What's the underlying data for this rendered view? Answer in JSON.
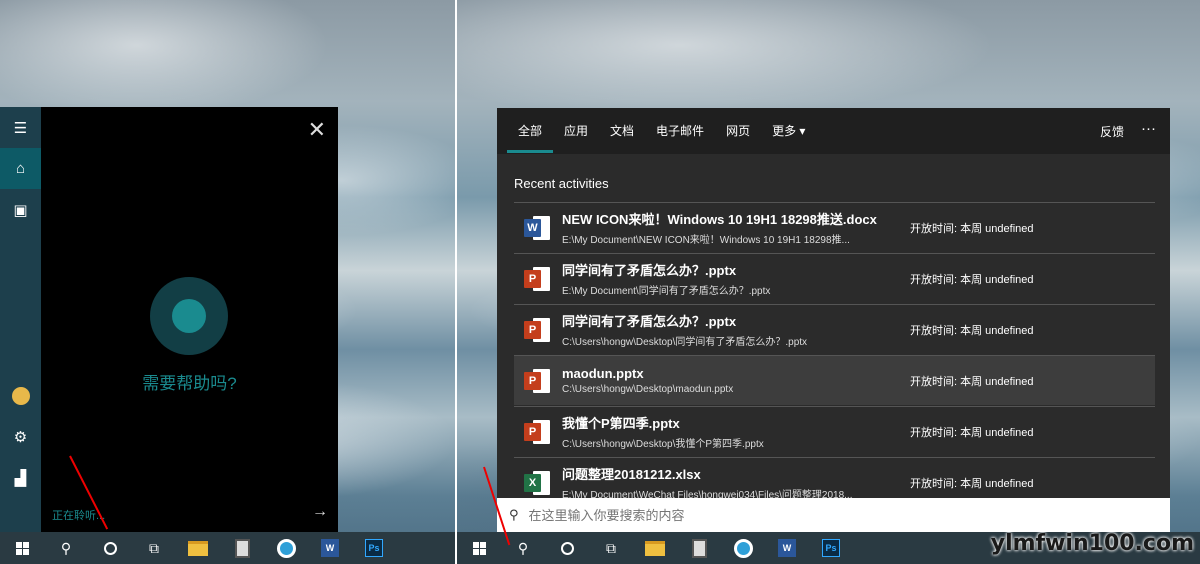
{
  "cortana": {
    "help_text": "需要帮助吗?",
    "listening_text": "正在聆听...",
    "close_glyph": "✕",
    "send_glyph": "→"
  },
  "search": {
    "tabs": [
      {
        "label": "全部"
      },
      {
        "label": "应用"
      },
      {
        "label": "文档"
      },
      {
        "label": "电子邮件"
      },
      {
        "label": "网页"
      },
      {
        "label": "更多 ▾"
      }
    ],
    "feedback_label": "反馈",
    "more_glyph": "···",
    "recent_title": "Recent activities",
    "items": [
      {
        "name": "NEW ICON来啦！Windows 10 19H1 18298推送.docx",
        "path": "E:\\My Document\\NEW ICON来啦！Windows 10 19H1 18298推...",
        "opened": "开放时间: 本周 undefined",
        "icon": "word-icon",
        "letter": "W"
      },
      {
        "name": "同学间有了矛盾怎么办？.pptx",
        "path": "E:\\My Document\\同学间有了矛盾怎么办？.pptx",
        "opened": "开放时间: 本周 undefined",
        "icon": "powerpoint-icon",
        "letter": "P"
      },
      {
        "name": "同学间有了矛盾怎么办？.pptx",
        "path": "C:\\Users\\hongw\\Desktop\\同学间有了矛盾怎么办？.pptx",
        "opened": "开放时间: 本周 undefined",
        "icon": "powerpoint-icon",
        "letter": "P"
      },
      {
        "name": "maodun.pptx",
        "path": "C:\\Users\\hongw\\Desktop\\maodun.pptx",
        "opened": "开放时间: 本周 undefined",
        "icon": "powerpoint-icon",
        "letter": "P"
      },
      {
        "name": "我懂个P第四季.pptx",
        "path": "C:\\Users\\hongw\\Desktop\\我懂个P第四季.pptx",
        "opened": "开放时间: 本周 undefined",
        "icon": "powerpoint-icon",
        "letter": "P"
      },
      {
        "name": "问题整理20181212.xlsx",
        "path": "E:\\My Document\\WeChat Files\\hongwei034\\Files\\问题整理2018...",
        "opened": "开放时间: 本周 undefined",
        "icon": "excel-icon",
        "letter": "X"
      }
    ],
    "box_placeholder": "在这里输入你要搜索的内容"
  },
  "taskbar": {
    "ps_label": "Ps",
    "word_label": "W"
  },
  "watermark": "ylmfwin100.com"
}
